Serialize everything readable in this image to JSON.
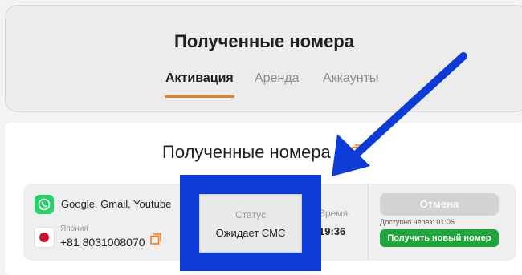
{
  "header": {
    "title": "Полученные номера",
    "tabs": [
      {
        "label": "Активация",
        "active": true
      },
      {
        "label": "Аренда",
        "active": false
      },
      {
        "label": "Аккаунты",
        "active": false
      }
    ]
  },
  "main": {
    "title": "Полученные номера",
    "rows": [
      {
        "services": "Google, Gmail, Youtube",
        "service_icon": "whatsapp-icon",
        "country": "Япония",
        "country_icon": "japan-flag-icon",
        "number": "+81 8031008070",
        "status_label": "Статус",
        "status_value": "Ожидает СМС",
        "time_label": "Время",
        "time_value": "19:36",
        "cancel_label": "Отмена",
        "available_text": "Доступно через: 01:06",
        "new_number_label": "Получить новый номер"
      }
    ]
  },
  "colors": {
    "accent": "#f07c1a",
    "success": "#1fa63a",
    "annotation": "#0d3bd8"
  }
}
